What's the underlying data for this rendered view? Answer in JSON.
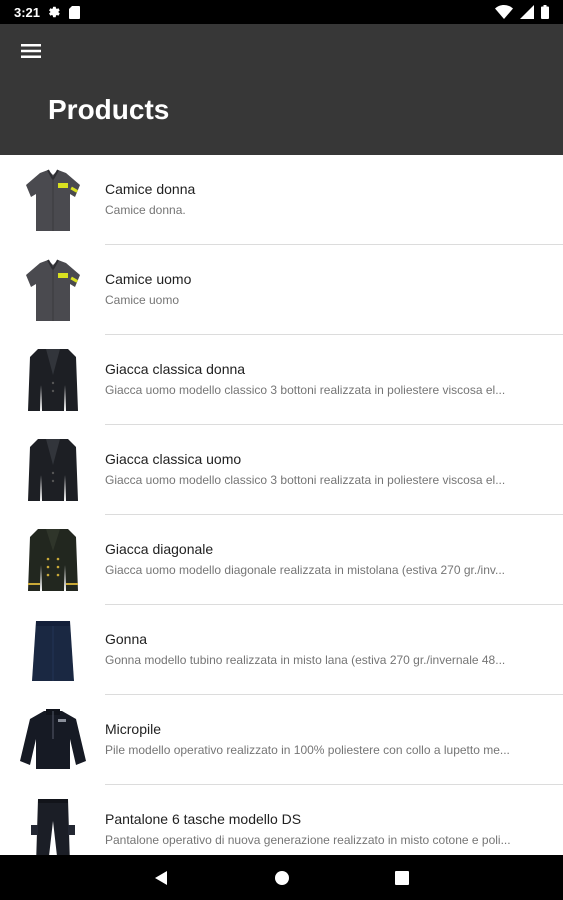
{
  "status": {
    "time": "3:21",
    "icons": [
      "settings-icon",
      "sd-card-icon",
      "wifi-icon",
      "battery-icon"
    ]
  },
  "toolbar": {
    "menu_icon": "menu-icon",
    "title": "Products",
    "background": "#373737"
  },
  "products": [
    {
      "title": "Camice donna",
      "subtitle": "Camice donna.",
      "image": "shirt-image"
    },
    {
      "title": "Camice uomo",
      "subtitle": "Camice uomo",
      "image": "shirt-image"
    },
    {
      "title": "Giacca classica donna",
      "subtitle": "Giacca uomo modello classico 3 bottoni realizzata in poliestere viscosa el...",
      "image": "jacket-image"
    },
    {
      "title": "Giacca classica uomo",
      "subtitle": "Giacca uomo modello classico 3 bottoni realizzata in poliestere viscosa el...",
      "image": "jacket-image"
    },
    {
      "title": "Giacca diagonale",
      "subtitle": "Giacca uomo modello diagonale realizzata in mistolana (estiva 270 gr./inv...",
      "image": "uniform-jacket-image"
    },
    {
      "title": "Gonna",
      "subtitle": "Gonna modello tubino realizzata in misto lana (estiva 270 gr./invernale 48...",
      "image": "skirt-image"
    },
    {
      "title": "Micropile",
      "subtitle": "Pile modello operativo realizzato in 100% poliestere con collo a lupetto me...",
      "image": "fleece-image"
    },
    {
      "title": "Pantalone 6 tasche modello DS",
      "subtitle": "Pantalone operativo di nuova generazione realizzato in misto cotone e poli...",
      "image": "trousers-image"
    }
  ],
  "nav": {
    "back": "back-icon",
    "home": "home-icon",
    "recents": "recents-icon"
  }
}
